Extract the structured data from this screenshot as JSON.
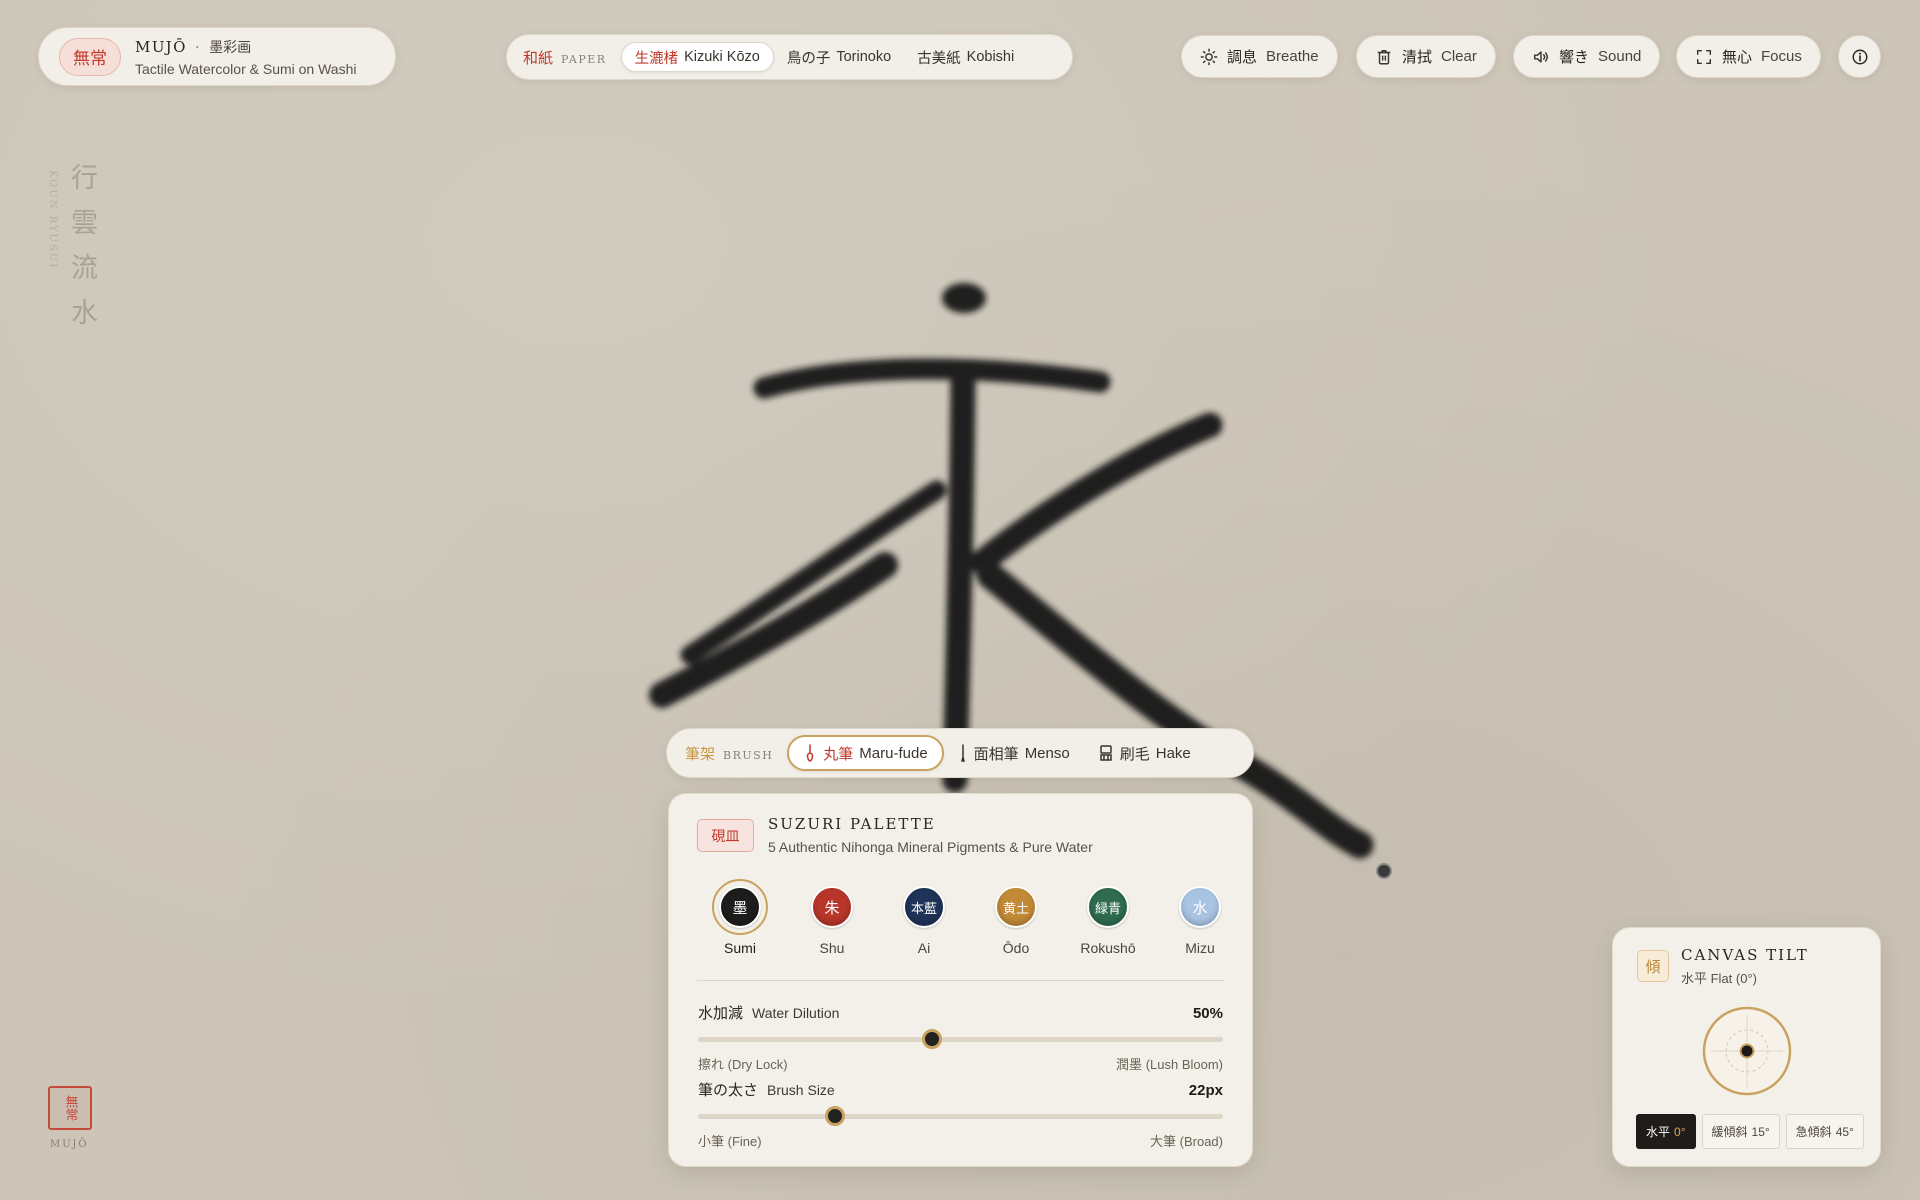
{
  "brand": {
    "seal": "無常",
    "name": "MUJŌ",
    "separator": "·",
    "name_jp": "墨彩画",
    "subtitle": "Tactile Watercolor & Sumi on Washi"
  },
  "paper": {
    "label_jp": "和紙",
    "label_en": "PAPER",
    "options": [
      {
        "jp": "生漉楮",
        "en": "Kizuki Kōzo",
        "active": true
      },
      {
        "jp": "鳥の子",
        "en": "Torinoko",
        "active": false
      },
      {
        "jp": "古美紙",
        "en": "Kobishi",
        "active": false
      }
    ]
  },
  "actions": {
    "breathe": {
      "jp": "調息",
      "en": "Breathe",
      "icon": "sun-icon"
    },
    "clear": {
      "jp": "清拭",
      "en": "Clear",
      "icon": "trash-icon"
    },
    "sound": {
      "jp": "響き",
      "en": "Sound",
      "icon": "speaker-icon"
    },
    "focus": {
      "jp": "無心",
      "en": "Focus",
      "icon": "expand-icon"
    },
    "info": {
      "icon": "info-icon"
    }
  },
  "poem": {
    "chars": [
      "行",
      "雲",
      "流",
      "水"
    ],
    "romaji": "KOUN RYUSUI"
  },
  "stamp": {
    "seal": "無常",
    "label": "MUJŌ"
  },
  "brush": {
    "label_jp": "筆架",
    "label_en": "BRUSH",
    "options": [
      {
        "jp": "丸筆",
        "en": "Maru-fude",
        "icon": "round-brush-icon",
        "active": true
      },
      {
        "jp": "面相筆",
        "en": "Menso",
        "icon": "fine-brush-icon",
        "active": false
      },
      {
        "jp": "刷毛",
        "en": "Hake",
        "icon": "flat-brush-icon",
        "active": false
      }
    ]
  },
  "palette": {
    "badge": "硯皿",
    "title": "SUZURI PALETTE",
    "subtitle": "5 Authentic Nihonga Mineral Pigments & Pure Water",
    "swatches": [
      {
        "glyph": "墨",
        "name": "Sumi",
        "color": "#1e1d1c",
        "selected": true
      },
      {
        "glyph": "朱",
        "name": "Shu",
        "color": "#b8362a",
        "selected": false
      },
      {
        "glyph": "本藍",
        "name": "Ai",
        "color": "#1f3358",
        "selected": false
      },
      {
        "glyph": "黄土",
        "name": "Ōdo",
        "color": "#c18a36",
        "selected": false
      },
      {
        "glyph": "緑青",
        "name": "Rokushō",
        "color": "#2f6b4f",
        "selected": false
      },
      {
        "glyph": "水",
        "name": "Mizu",
        "color": "#a9c4e2",
        "selected": false
      }
    ],
    "water": {
      "label_jp": "水加減",
      "label_en": "Water Dilution",
      "value": "50%",
      "fraction": 0.445,
      "min_jp": "擦れ",
      "min_en": "(Dry Lock)",
      "max_jp": "潤墨",
      "max_en": "(Lush Bloom)"
    },
    "size": {
      "label_jp": "筆の太さ",
      "label_en": "Brush Size",
      "value": "22px",
      "fraction": 0.26,
      "min_jp": "小筆",
      "min_en": "(Fine)",
      "max_jp": "大筆",
      "max_en": "(Broad)"
    }
  },
  "tilt": {
    "badge": "傾",
    "title": "CANVAS TILT",
    "subtitle": "水平 Flat (0°)",
    "options": [
      {
        "jp": "水平",
        "deg": "0°",
        "active": true
      },
      {
        "jp": "緩傾斜",
        "deg": "15°",
        "active": false
      },
      {
        "jp": "急傾斜",
        "deg": "45°",
        "active": false
      }
    ]
  },
  "colors": {
    "paper_bg": "#ccc5b8",
    "vermilion": "#c0392b",
    "gold_accent": "#c9a25f",
    "ink": "#141414"
  }
}
